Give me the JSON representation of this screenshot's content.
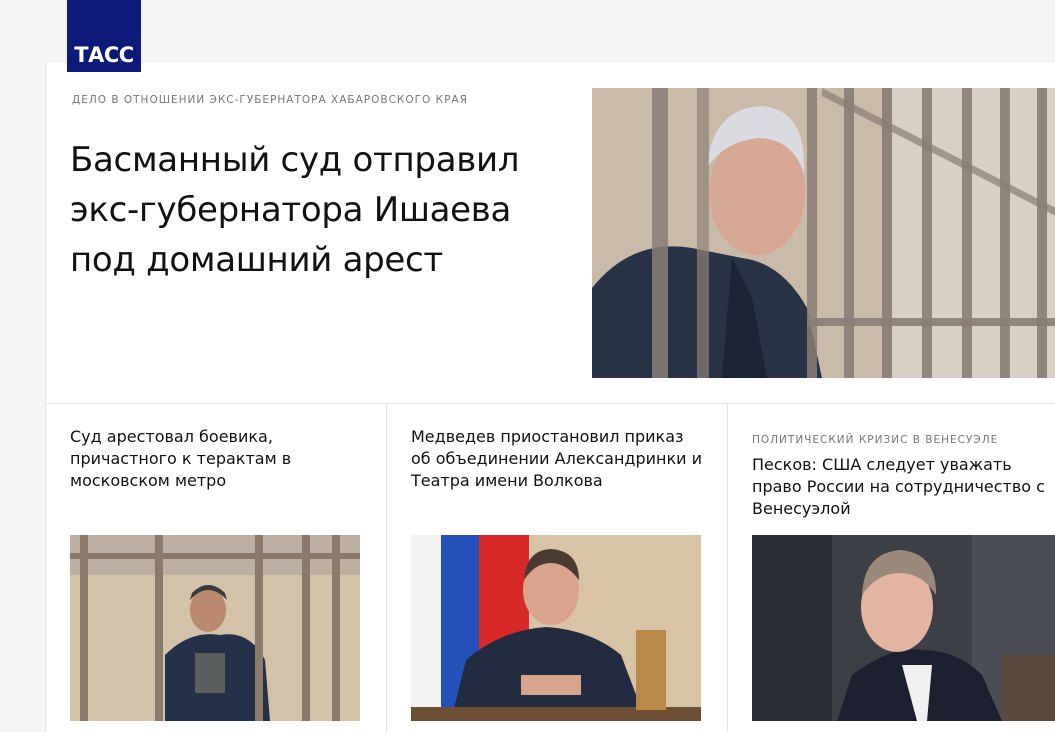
{
  "logo": {
    "text": "ТАСС"
  },
  "hero": {
    "category": "ДЕЛО В ОТНОШЕНИИ ЭКС-ГУБЕРНАТОРА ХАБАРОВСКОГО КРАЯ",
    "title": "Басманный суд отправил экс-губернатора Ишаева под домашний арест"
  },
  "cards": [
    {
      "category": "",
      "title": "Суд арестовал боевика, причастного к терактам в московском метро"
    },
    {
      "category": "",
      "title": "Медведев приостановил приказ об объединении Александринки и Театра имени Волкова"
    },
    {
      "category": "ПОЛИТИЧЕСКИЙ КРИЗИС В ВЕНЕСУЭЛЕ",
      "title": "Песков: США следует уважать право России на сотрудничество с Венесуэлой"
    }
  ],
  "colors": {
    "brand": "#0e1a7a",
    "text": "#111111",
    "muted": "#777777",
    "divider": "#e3e3e3"
  }
}
